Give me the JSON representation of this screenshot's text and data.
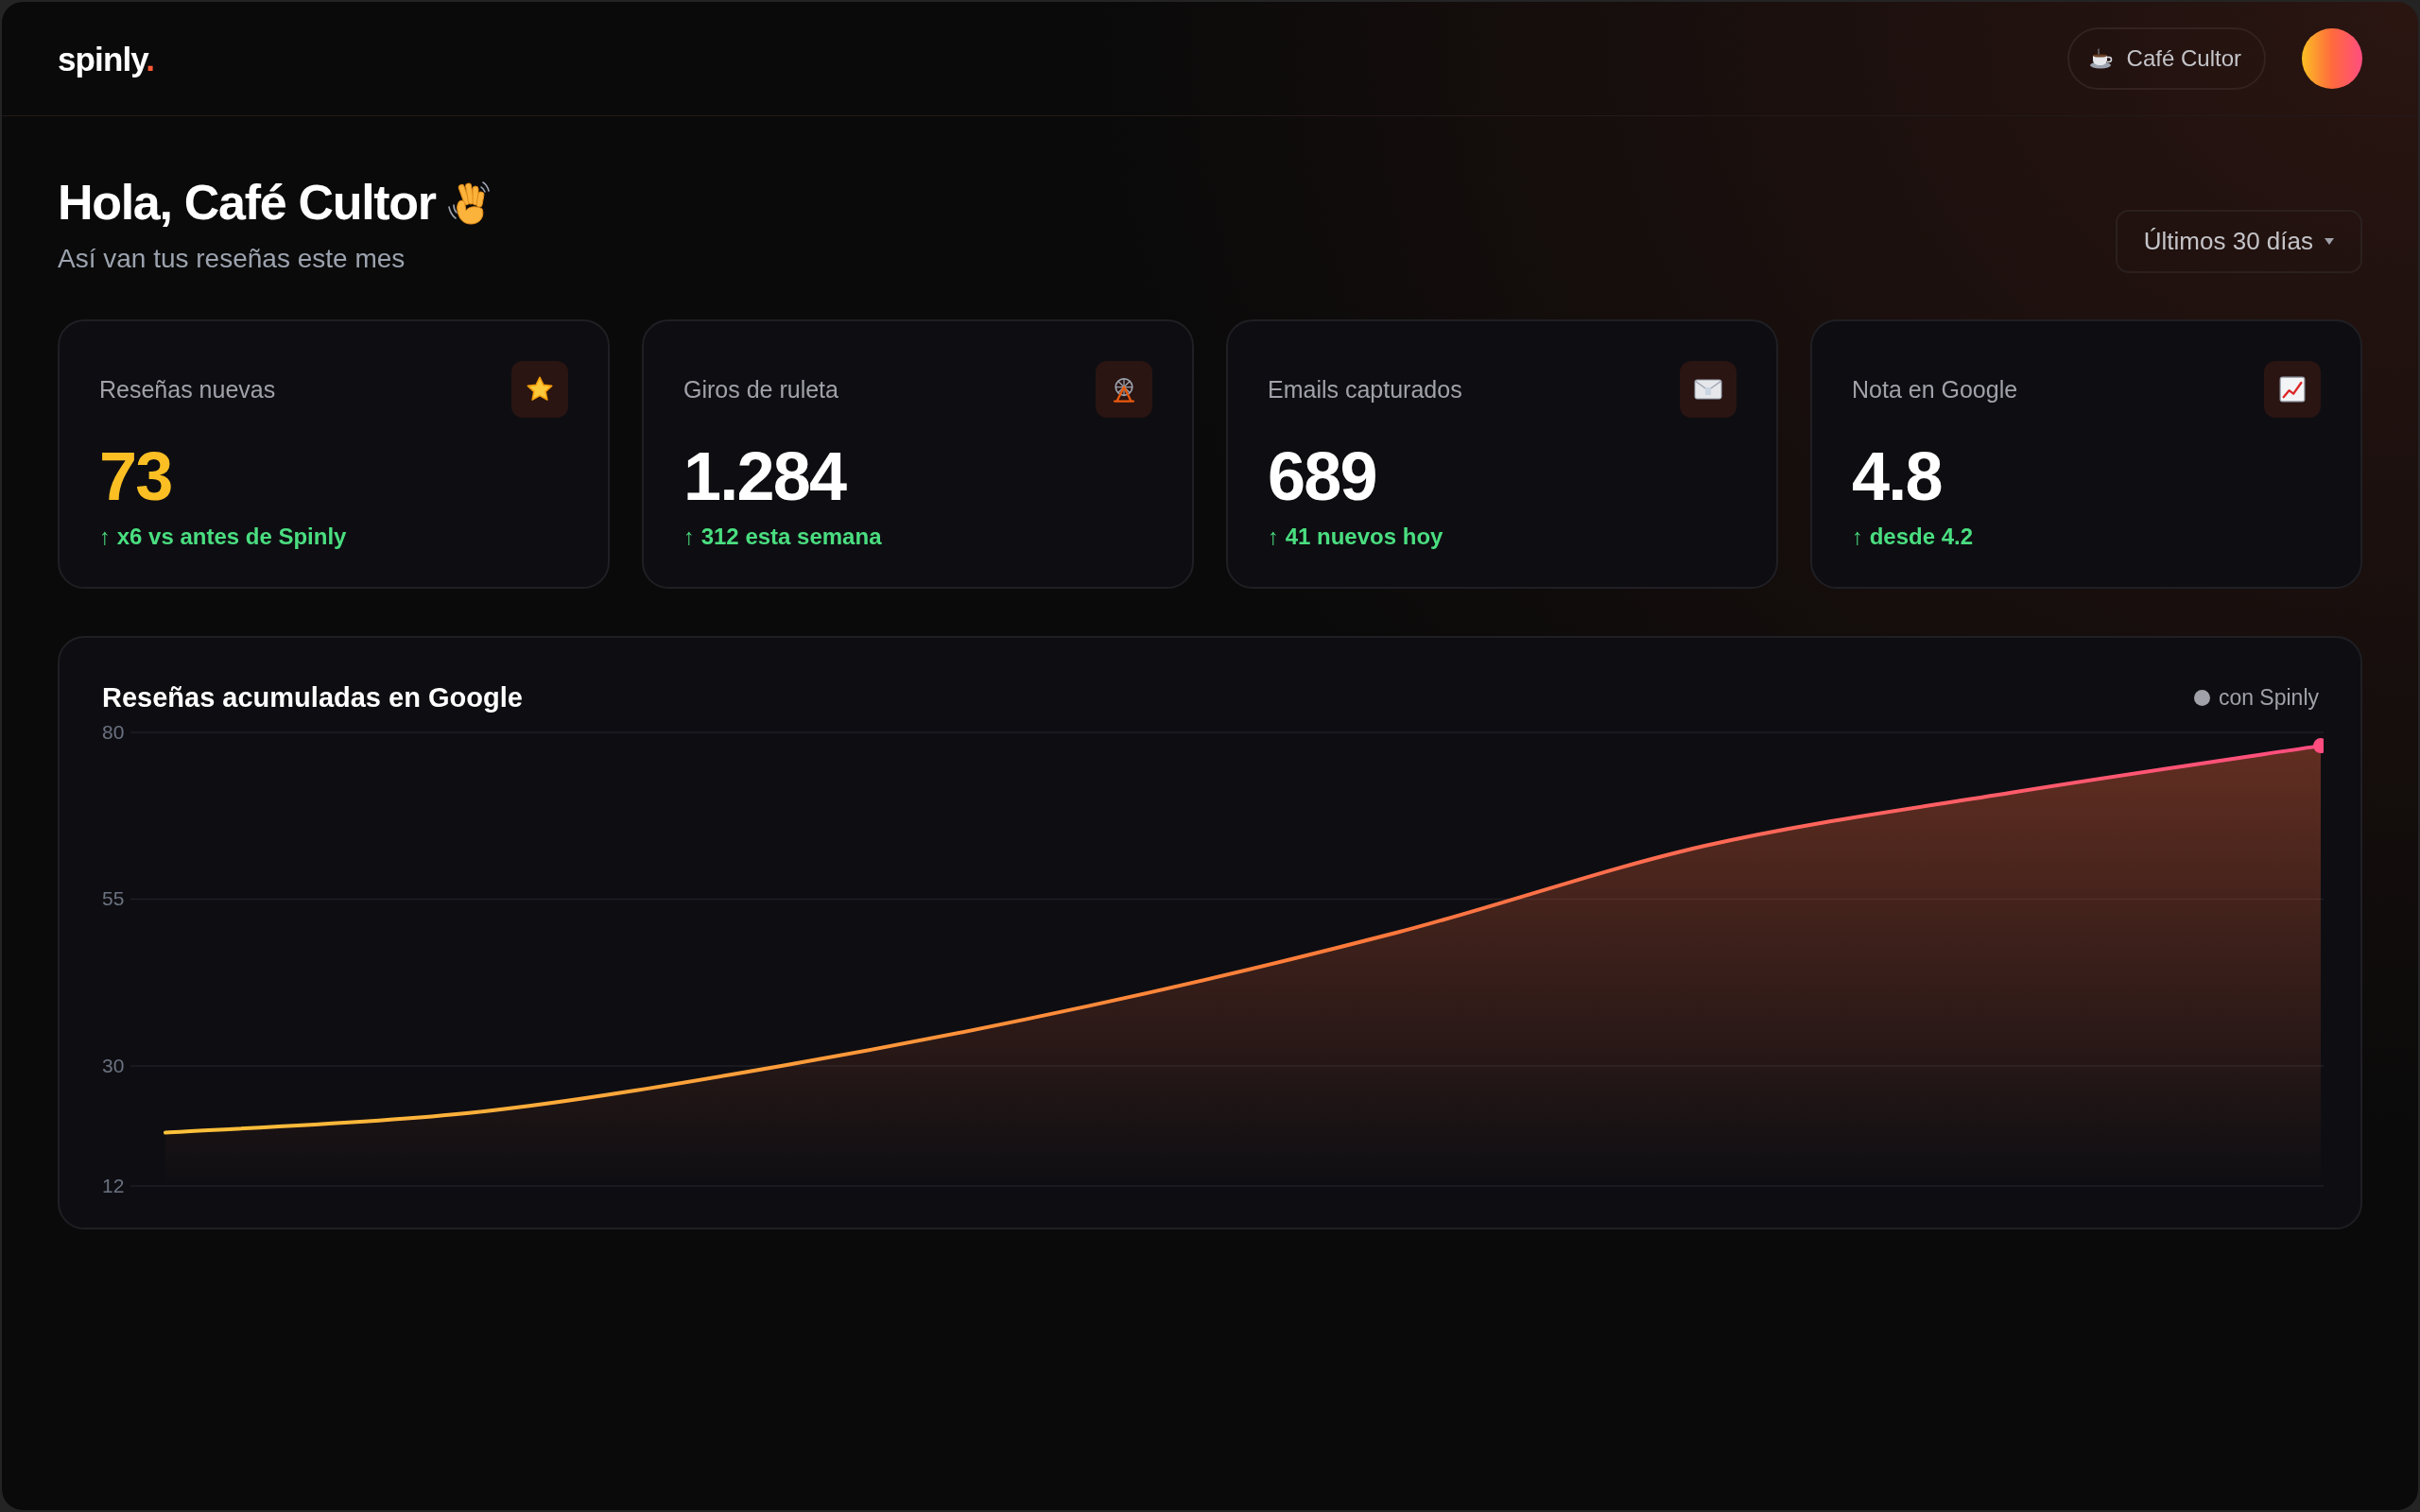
{
  "header": {
    "logo": {
      "text": "spinly",
      "accent": "."
    },
    "business": {
      "label": "Café Cultor"
    }
  },
  "greeting": {
    "title": "Hola, Café Cultor",
    "subtitle": "Así van tus reseñas este mes"
  },
  "period_select": {
    "label": "Últimos 30 días"
  },
  "stats": [
    {
      "label": "Reseñas nuevas",
      "value": "73",
      "highlighted": true,
      "delta": "↑ x6 vs antes de Spinly"
    },
    {
      "label": "Giros de ruleta",
      "value": "1.284",
      "highlighted": false,
      "delta": "↑ 312 esta semana"
    },
    {
      "label": "Emails capturados",
      "value": "689",
      "highlighted": false,
      "delta": "↑ 41 nuevos hoy"
    },
    {
      "label": "Nota en Google",
      "value": "4.8",
      "highlighted": false,
      "delta": "↑ desde 4.2"
    }
  ],
  "chart": {
    "title": "Reseñas acumuladas en Google",
    "chart_data": {
      "type": "area",
      "ylim": [
        12,
        80
      ],
      "yticks": [
        80,
        55,
        30,
        12
      ],
      "series": [
        {
          "name": "con Spinly",
          "color": "#ff4d80",
          "values": [
            20,
            23,
            30,
            39,
            50,
            63,
            71,
            78
          ]
        }
      ]
    }
  }
}
